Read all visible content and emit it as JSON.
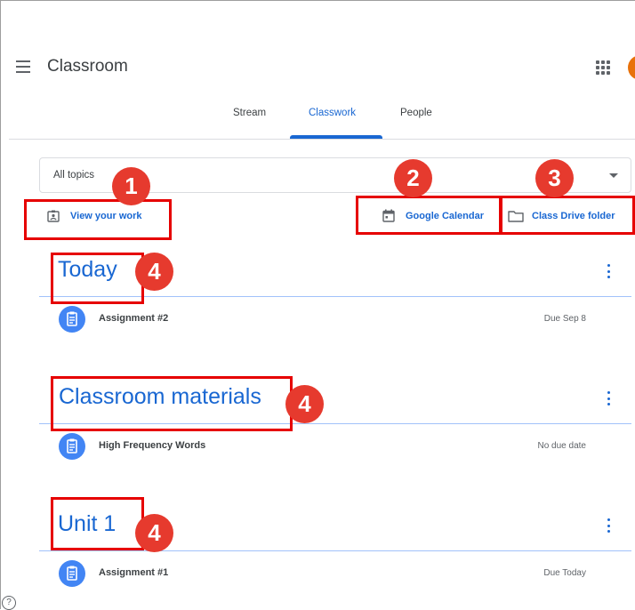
{
  "header": {
    "app_title": "Classroom"
  },
  "tabs": [
    {
      "label": "Stream"
    },
    {
      "label": "Classwork"
    },
    {
      "label": "People"
    }
  ],
  "topics_filter": {
    "selected": "All topics"
  },
  "actions": {
    "view_work": "View your work",
    "google_calendar": "Google Calendar",
    "drive_folder": "Class Drive folder"
  },
  "badges": [
    "1",
    "2",
    "3",
    "4"
  ],
  "topics": [
    {
      "title": "Today",
      "items": [
        {
          "title": "Assignment #2",
          "due": "Due Sep 8"
        }
      ]
    },
    {
      "title": "Classroom materials",
      "items": [
        {
          "title": "High Frequency Words",
          "due": "No due date"
        }
      ]
    },
    {
      "title": "Unit 1",
      "items": [
        {
          "title": "Assignment #1",
          "due": "Due Today"
        }
      ]
    }
  ],
  "help": "?",
  "colors": {
    "accent": "#1967d2",
    "annotation_red": "#e60000",
    "badge_red": "#e63a2e",
    "avatar": "#e8710a"
  },
  "icons": {
    "menu": "hamburger-menu-icon",
    "apps": "apps-grid-icon",
    "view_work": "assignment-ind-icon",
    "calendar": "calendar-icon",
    "drive": "folder-icon",
    "more": "more-vert-icon",
    "item": "assignment-icon",
    "help": "help-icon"
  }
}
